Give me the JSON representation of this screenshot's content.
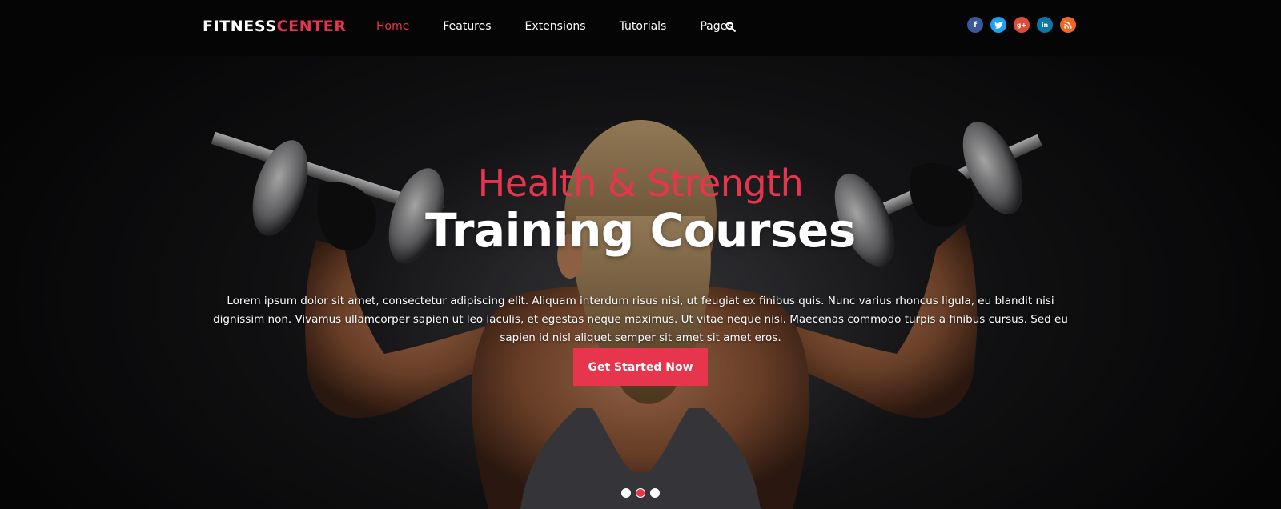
{
  "brand": {
    "part1": "FITNESS",
    "part2": "CENTER"
  },
  "nav": {
    "items": [
      {
        "label": "Home",
        "active": true
      },
      {
        "label": "Features",
        "active": false
      },
      {
        "label": "Extensions",
        "active": false
      },
      {
        "label": "Tutorials",
        "active": false
      },
      {
        "label": "Pages",
        "active": false
      }
    ],
    "search_icon": "search-icon"
  },
  "social": [
    {
      "name": "facebook-icon",
      "glyph": "f",
      "color": "#3b5998"
    },
    {
      "name": "twitter-icon",
      "glyph": "t",
      "color": "#1da1f2"
    },
    {
      "name": "google-plus-icon",
      "glyph": "g+",
      "color": "#dd4b39"
    },
    {
      "name": "linkedin-icon",
      "glyph": "in",
      "color": "#0e76a8"
    },
    {
      "name": "rss-icon",
      "glyph": "rss",
      "color": "#f26522"
    }
  ],
  "hero": {
    "kicker": "Health & Strength",
    "title": "Training Courses",
    "description": "Lorem ipsum dolor sit amet, consectetur adipiscing elit. Aliquam interdum risus nisi, ut feugiat ex finibus quis. Nunc varius rhoncus ligula, eu blandit nisi dignissim non. Vivamus ullamcorper sapien ut leo iaculis, et egestas neque maximus. Ut vitae neque nisi. Maecenas commodo turpis a finibus cursus. Sed eu sapien id nisl aliquet semper sit amet sit amet eros.",
    "cta_label": "Get Started Now"
  },
  "slider": {
    "count": 3,
    "active_index": 1
  },
  "colors": {
    "accent": "#e8354e",
    "topbar": "#050505",
    "text": "#ffffff"
  }
}
